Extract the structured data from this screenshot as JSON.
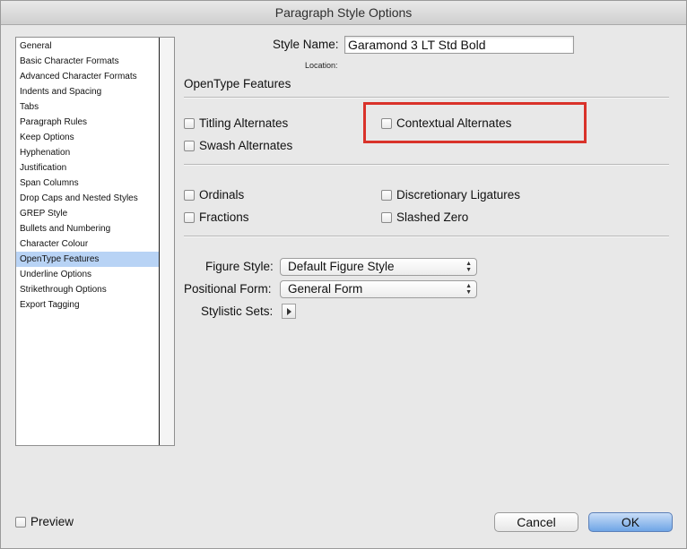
{
  "window": {
    "title": "Paragraph Style Options"
  },
  "sidebar": {
    "items": [
      {
        "label": "General"
      },
      {
        "label": "Basic Character Formats"
      },
      {
        "label": "Advanced Character Formats"
      },
      {
        "label": "Indents and Spacing"
      },
      {
        "label": "Tabs"
      },
      {
        "label": "Paragraph Rules"
      },
      {
        "label": "Keep Options"
      },
      {
        "label": "Hyphenation"
      },
      {
        "label": "Justification"
      },
      {
        "label": "Span Columns"
      },
      {
        "label": "Drop Caps and Nested Styles"
      },
      {
        "label": "GREP Style"
      },
      {
        "label": "Bullets and Numbering"
      },
      {
        "label": "Character Colour"
      },
      {
        "label": "OpenType Features"
      },
      {
        "label": "Underline Options"
      },
      {
        "label": "Strikethrough Options"
      },
      {
        "label": "Export Tagging"
      }
    ],
    "selected": "OpenType Features"
  },
  "header": {
    "style_name_label": "Style Name:",
    "style_name_value": "Garamond 3 LT Std Bold",
    "location_label": "Location:"
  },
  "section": {
    "title": "OpenType Features"
  },
  "options": {
    "titling": "Titling Alternates",
    "contextual": "Contextual Alternates",
    "swash": "Swash Alternates",
    "ordinals": "Ordinals",
    "discretionary": "Discretionary Ligatures",
    "fractions": "Fractions",
    "slashed_zero": "Slashed Zero"
  },
  "selects": {
    "figure_style_label": "Figure Style:",
    "figure_style_value": "Default Figure Style",
    "positional_form_label": "Positional Form:",
    "positional_form_value": "General Form",
    "stylistic_sets_label": "Stylistic Sets:"
  },
  "footer": {
    "preview": "Preview",
    "cancel": "Cancel",
    "ok": "OK"
  },
  "colors": {
    "highlight": "#d9322a",
    "selection": "#b8d3f5",
    "ok_button": "#6fa5e6"
  }
}
